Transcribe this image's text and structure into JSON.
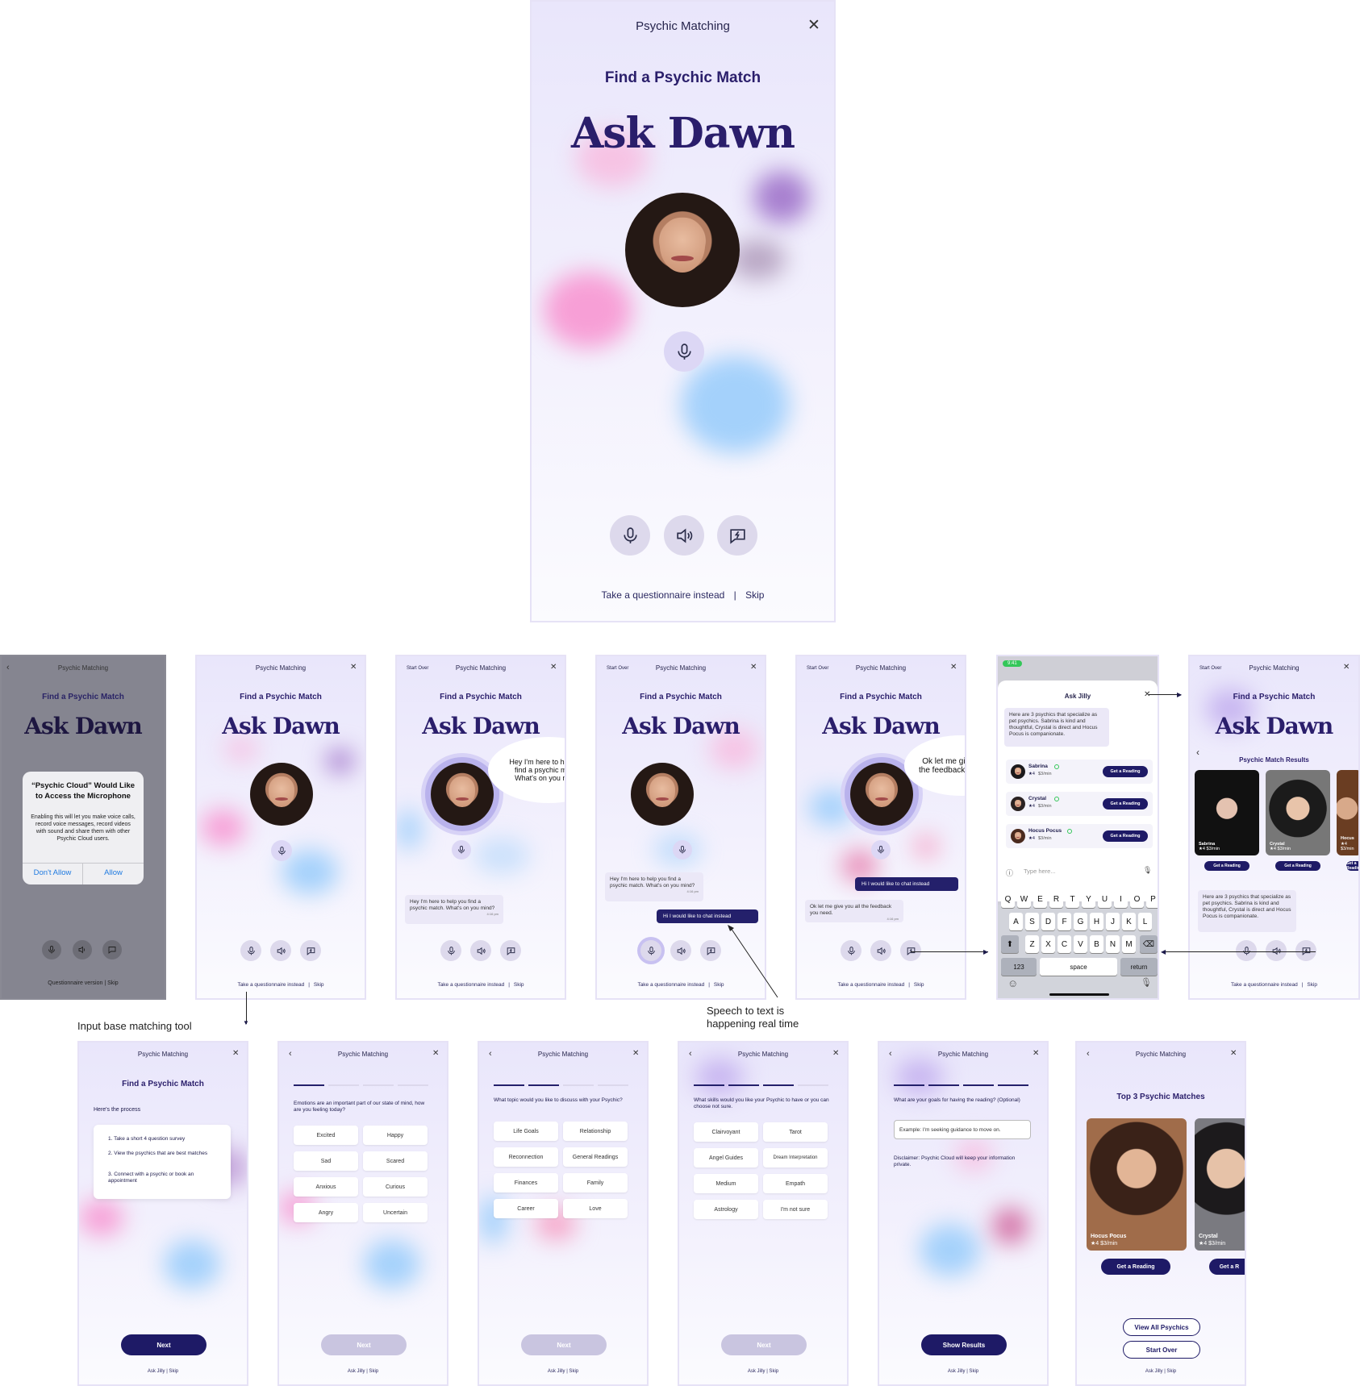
{
  "app": {
    "title": "Psychic Matching",
    "find_title": "Find a Psychic Match",
    "hero": "Ask Dawn",
    "start_over": "Start Over"
  },
  "main": {
    "links": {
      "questionnaire": "Take a questionnaire instead",
      "separator": "|",
      "skip": "Skip"
    }
  },
  "icons": {
    "mic": "mic-icon",
    "speaker": "speaker-icon",
    "chat": "chat-bolt-icon",
    "close": "close-icon",
    "back": "chevron-left-icon"
  },
  "permission": {
    "title": "“Psychic Cloud” Would Like to Access the Microphone",
    "body": "Enabling this will let you make voice calls, record voice messages, record videos with sound and share them with other Psychic Cloud users.",
    "deny": "Don't Allow",
    "allow": "Allow",
    "links": "Questionnaire version  |  Skip"
  },
  "chat": {
    "dawn_intro": "Hey I'm here to help you find a psychic match. What's on you mind?",
    "user_msg": "Hi I would like to chat instead",
    "dawn_feedback": "Ok let me give you all the feedback you need.",
    "time": "4:16 pm"
  },
  "jilly": {
    "status_time": "9:41",
    "title": "Ask Jilly",
    "summary": "Here are 3 psychics that specialize as pet psychics. Sabrina is kind and thoughtful, Crystal is direct and Hocus Pocus is companionate.",
    "input_placeholder": "Type here...",
    "psychics": [
      {
        "name": "Sabrina",
        "rating": "★4",
        "price": "$3/min",
        "cta": "Get a Reading"
      },
      {
        "name": "Crystal",
        "rating": "★4",
        "price": "$3/min",
        "cta": "Get a Reading"
      },
      {
        "name": "Hocus Pocus",
        "rating": "★4",
        "price": "$3/min",
        "cta": "Get a Reading"
      }
    ],
    "keyboard": {
      "row1": [
        "Q",
        "W",
        "E",
        "R",
        "T",
        "Y",
        "U",
        "I",
        "O",
        "P"
      ],
      "row2": [
        "A",
        "S",
        "D",
        "F",
        "G",
        "H",
        "J",
        "K",
        "L"
      ],
      "row3": [
        "Z",
        "X",
        "C",
        "V",
        "B",
        "N",
        "M"
      ],
      "num": "123",
      "space": "space",
      "ret": "return"
    }
  },
  "results": {
    "title": "Psychic Match Results",
    "cards": [
      {
        "name": "Sabrina",
        "meta": "★4  $3/min"
      },
      {
        "name": "Crystal",
        "meta": "★4  $3/min"
      },
      {
        "name": "Hocus",
        "meta": "★4  $3/min"
      }
    ],
    "cta": "Get a Reading"
  },
  "annotations": {
    "input_tool": "Input base matching tool",
    "speech": "Speech to text is happening real time"
  },
  "survey": {
    "footer": "Ask Jilly  |  Skip",
    "intro_heading": "Here's the process",
    "steps": [
      "1.  Take a short 4 question survey",
      "2.  View the psychics that are best matches",
      "3.  Connect with a psychic or book an appointment"
    ],
    "next": "Next",
    "q1": "Emotions are an important part of our state of mind, how are you feeling today?",
    "q1_opts": [
      "Excited",
      "Happy",
      "Sad",
      "Scared",
      "Anxious",
      "Curious",
      "Angry",
      "Uncertain"
    ],
    "q2": "What topic would you like to discuss with your Psychic?",
    "q2_opts": [
      "Life Goals",
      "Relationship",
      "Reconnection",
      "General Readings",
      "Finances",
      "Family",
      "Career",
      "Love"
    ],
    "q3": "What skills would you like your Psychic to have or you can choose not sure.",
    "q3_opts": [
      "Clairvoyant",
      "Tarot",
      "Angel Guides",
      "Dream Interpretation",
      "Medium",
      "Empath",
      "Astrology",
      "I'm not sure"
    ],
    "q4": "What are your goals for having the reading? (Optional)",
    "q4_placeholder": "Example: I'm seeking guidance to move on.",
    "disclaimer": "Disclaimer: Psychic Cloud will keep your information private.",
    "show_results": "Show Results",
    "top_title": "Top 3 Psychic Matches",
    "top_cards": [
      {
        "name": "Hocus Pocus",
        "meta": "★4   $3/min"
      },
      {
        "name": "Crystal",
        "meta": "★4   $3/min"
      }
    ],
    "get_reading": "Get a Reading",
    "get_reading_cut": "Get a R",
    "view_all": "View All Psychics",
    "start_over": "Start Over"
  },
  "colors": {
    "primary": "#1e1a66",
    "accent": "#2a1e6b",
    "bg": "#ece9fb",
    "ios_blue": "#1f7ae0"
  }
}
